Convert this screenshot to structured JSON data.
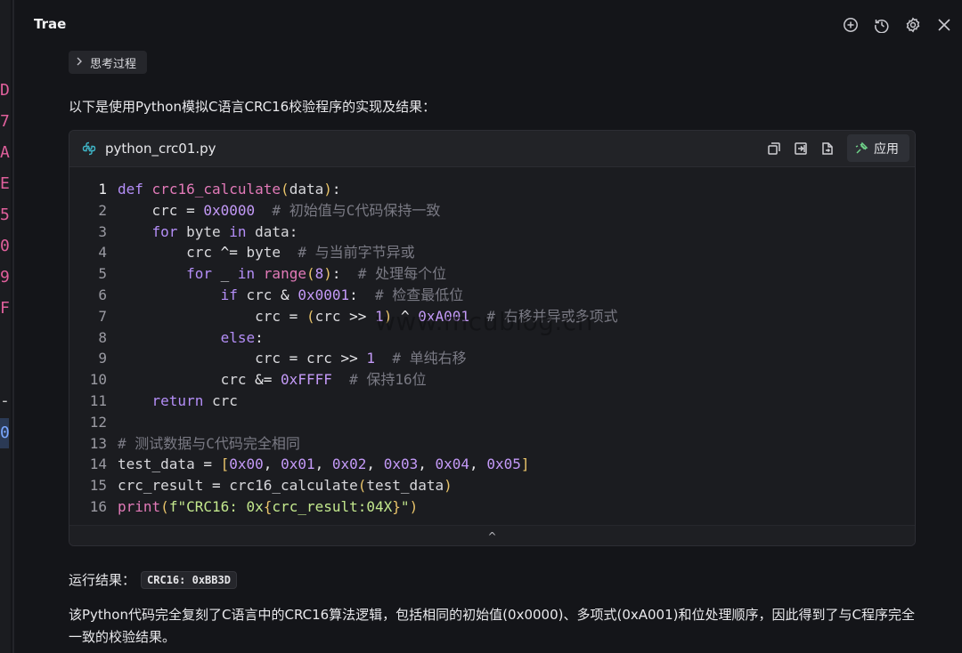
{
  "left_strip": {
    "ticks": [
      "D",
      "7",
      "A",
      "E",
      "5",
      "0",
      "9",
      "F"
    ],
    "dash": "-",
    "selected": "0"
  },
  "header": {
    "title": "Trae"
  },
  "header_icons": [
    "add-chat-icon",
    "history-icon",
    "settings-icon",
    "close-icon"
  ],
  "thinking": {
    "label": "思考过程"
  },
  "intro_text": "以下是使用Python模拟C语言CRC16校验程序的实现及结果：",
  "code_block": {
    "filename": "python_crc01.py",
    "apply_label": "应用",
    "toolbar_icons": [
      "copy-icon",
      "insert-icon",
      "new-file-icon"
    ],
    "lines": [
      {
        "n": "1"
      },
      {
        "n": "2"
      },
      {
        "n": "3"
      },
      {
        "n": "4"
      },
      {
        "n": "5"
      },
      {
        "n": "6"
      },
      {
        "n": "7"
      },
      {
        "n": "8"
      },
      {
        "n": "9"
      },
      {
        "n": "10"
      },
      {
        "n": "11"
      },
      {
        "n": "12"
      },
      {
        "n": "13"
      },
      {
        "n": "14"
      },
      {
        "n": "15"
      },
      {
        "n": "16"
      }
    ],
    "tokens": {
      "l1": [
        "def",
        "crc16_calculate",
        "(",
        "data",
        ")",
        ":"
      ],
      "l2": [
        "crc",
        "=",
        "0x0000",
        "# 初始值与C代码保持一致"
      ],
      "l3": [
        "for",
        "byte",
        "in",
        "data:"
      ],
      "l4": [
        "crc",
        "^=",
        "byte",
        "# 与当前字节异或"
      ],
      "l5": [
        "for",
        "_",
        "in",
        "range",
        "(",
        "8",
        ")",
        ":",
        "# 处理每个位"
      ],
      "l6": [
        "if",
        "crc",
        "&",
        "0x0001",
        ":",
        "# 检查最低位"
      ],
      "l7": [
        "crc",
        "=",
        "(",
        "crc",
        ">>",
        "1",
        ")",
        "^",
        "0xA001",
        "# 右移并异或多项式"
      ],
      "l8": [
        "else",
        ":"
      ],
      "l9": [
        "crc",
        "=",
        "crc",
        ">>",
        "1",
        "# 单纯右移"
      ],
      "l10": [
        "crc",
        "&=",
        "0xFFFF",
        "# 保持16位"
      ],
      "l11": [
        "return",
        "crc"
      ],
      "l13": [
        "# 测试数据与C代码完全相同"
      ],
      "l14": [
        "test_data",
        "=",
        "[",
        "0x00",
        ",",
        "0x01",
        ",",
        "0x02",
        ",",
        "0x03",
        ",",
        "0x04",
        ",",
        "0x05",
        "]"
      ],
      "l15": [
        "crc_result",
        "=",
        "crc16_calculate",
        "(",
        "test_data",
        ")"
      ],
      "l16": [
        "print",
        "(",
        "f\"CRC16: 0x",
        "{",
        "crc_result:04X",
        "}",
        "\"",
        ")"
      ]
    },
    "collapse_label": "^"
  },
  "watermark": "www.mcublog.cn",
  "result": {
    "label": "运行结果：",
    "value": "CRC16: 0xBB3D"
  },
  "summary": "该Python代码完全复刻了C语言中的CRC16算法逻辑，包括相同的初始值(0x0000)、多项式(0xA001)和位处理顺序，因此得到了与C程序完全一致的校验结果。"
}
